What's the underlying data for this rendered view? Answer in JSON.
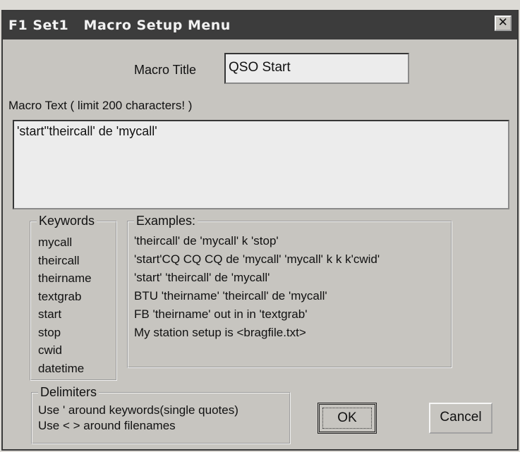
{
  "window": {
    "title": "F1 Set1   Macro Setup Menu",
    "close_symbol": "✕"
  },
  "macro_title": {
    "label": "Macro Title",
    "value": "QSO Start"
  },
  "macro_text": {
    "label": "Macro Text ( limit 200 characters! )",
    "value": "'start''theircall' de 'mycall'"
  },
  "keywords": {
    "legend": "Keywords",
    "items": [
      "mycall",
      "theircall",
      "theirname",
      "textgrab",
      "start",
      "stop",
      "cwid",
      "datetime"
    ]
  },
  "examples": {
    "legend": "Examples:",
    "items": [
      "'theircall' de 'mycall' k 'stop'",
      "'start'CQ CQ CQ de 'mycall' 'mycall' k k k'cwid'",
      "'start' 'theircall' de 'mycall'",
      "BTU 'theirname' 'theircall' de 'mycall'",
      "FB 'theirname' out in in 'textgrab'",
      "My station  setup is <bragfile.txt>"
    ]
  },
  "delimiters": {
    "legend": "Delimiters",
    "line1": "Use '  around keywords(single quotes)",
    "line2": "Use < > around filenames"
  },
  "buttons": {
    "ok": "OK",
    "cancel": "Cancel"
  }
}
